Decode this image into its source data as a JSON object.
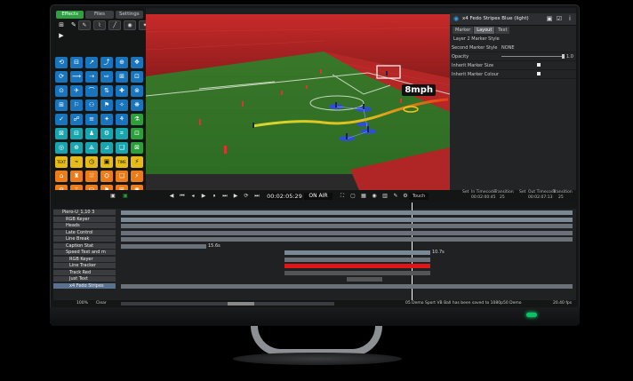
{
  "tabs": {
    "effects": "Effects",
    "files": "Files",
    "settings": "Settings"
  },
  "tools": [
    "draw-tool",
    "pen-tool",
    "camera-tool"
  ],
  "effect_icons": [
    [
      "⟲",
      "⊟",
      "↗",
      "⤴",
      "⊕",
      "❖"
    ],
    [
      "⟳",
      "⟿",
      "⇢",
      "⇨",
      "⊞",
      "⊡"
    ],
    [
      "⊙",
      "✈",
      "⌒",
      "⇅",
      "✚",
      "⊗"
    ],
    [
      "⊞",
      "⚐",
      "⚇",
      "⚑",
      "✧",
      "❋"
    ],
    [
      "✓",
      "☍",
      "≡",
      "✦",
      "⚘",
      "⚗"
    ],
    [
      "⊠",
      "⊟",
      "♟",
      "⚙",
      "⌗",
      "⊡"
    ],
    [
      "◎",
      "⊕",
      "⟁",
      "⊿",
      "❑",
      "⊠"
    ],
    [
      "TEXT",
      "⌁",
      "◷",
      "▣",
      "TIME",
      "⚡"
    ],
    [
      "⌂",
      "♜",
      "⛆",
      "⛭",
      "❏",
      "⚡"
    ],
    [
      "⚙",
      "⚚",
      "⛁",
      "⚑",
      "⊞",
      "✺"
    ]
  ],
  "video": {
    "speed_label": "8mph",
    "timecode": "00:02:05:29"
  },
  "props": {
    "title": "x4 Fedo Stripes Blue (light)",
    "tabs": [
      "Marker",
      "Layout",
      "Text"
    ],
    "section": "Layer 2 Marker Style",
    "rows": [
      {
        "label": "Second Marker Style",
        "value": "NONE"
      },
      {
        "label": "Opacity",
        "value": "1.0"
      },
      {
        "label": "Inherit Marker Size",
        "value": ""
      },
      {
        "label": "Inherit Marker Colour",
        "value": ""
      }
    ]
  },
  "transport": {
    "onair": "ON AIR",
    "touch": "Touch",
    "in_label": "In Timecode",
    "in_value": "00:02:00:45",
    "out_label": "Out Timecode",
    "out_value": "00:02:07:13",
    "trans_label": "Transition",
    "trans_in": "25",
    "trans_out": "25",
    "set": "Set"
  },
  "timeline": {
    "header_label": "Piero-U_1,10 3",
    "tracks": [
      {
        "name": "Piero-U_1,10 3",
        "level": 0
      },
      {
        "name": "RGB Keyer",
        "level": 1
      },
      {
        "name": "Heads",
        "level": 1
      },
      {
        "name": "Late Control",
        "level": 1
      },
      {
        "name": "Line Break",
        "level": 1
      },
      {
        "name": "Caption Stat",
        "level": 1
      },
      {
        "name": "Speed Text and m",
        "level": 1
      },
      {
        "name": "RGB Keyer",
        "level": 2
      },
      {
        "name": "Line Tracker",
        "level": 2
      },
      {
        "name": "Track Red",
        "level": 2
      },
      {
        "name": "Just Text",
        "level": 2
      },
      {
        "name": "x4 Fedo Stripes",
        "level": 2
      }
    ],
    "bar_labels": [
      "15.6s",
      "10.7s"
    ],
    "status_zoom": "100%",
    "status_clear": "Clear",
    "status_msg": "05 Demo Sport VB Ball has been saved to 1080p50 Demo",
    "status_fps": "20.40 fps"
  }
}
